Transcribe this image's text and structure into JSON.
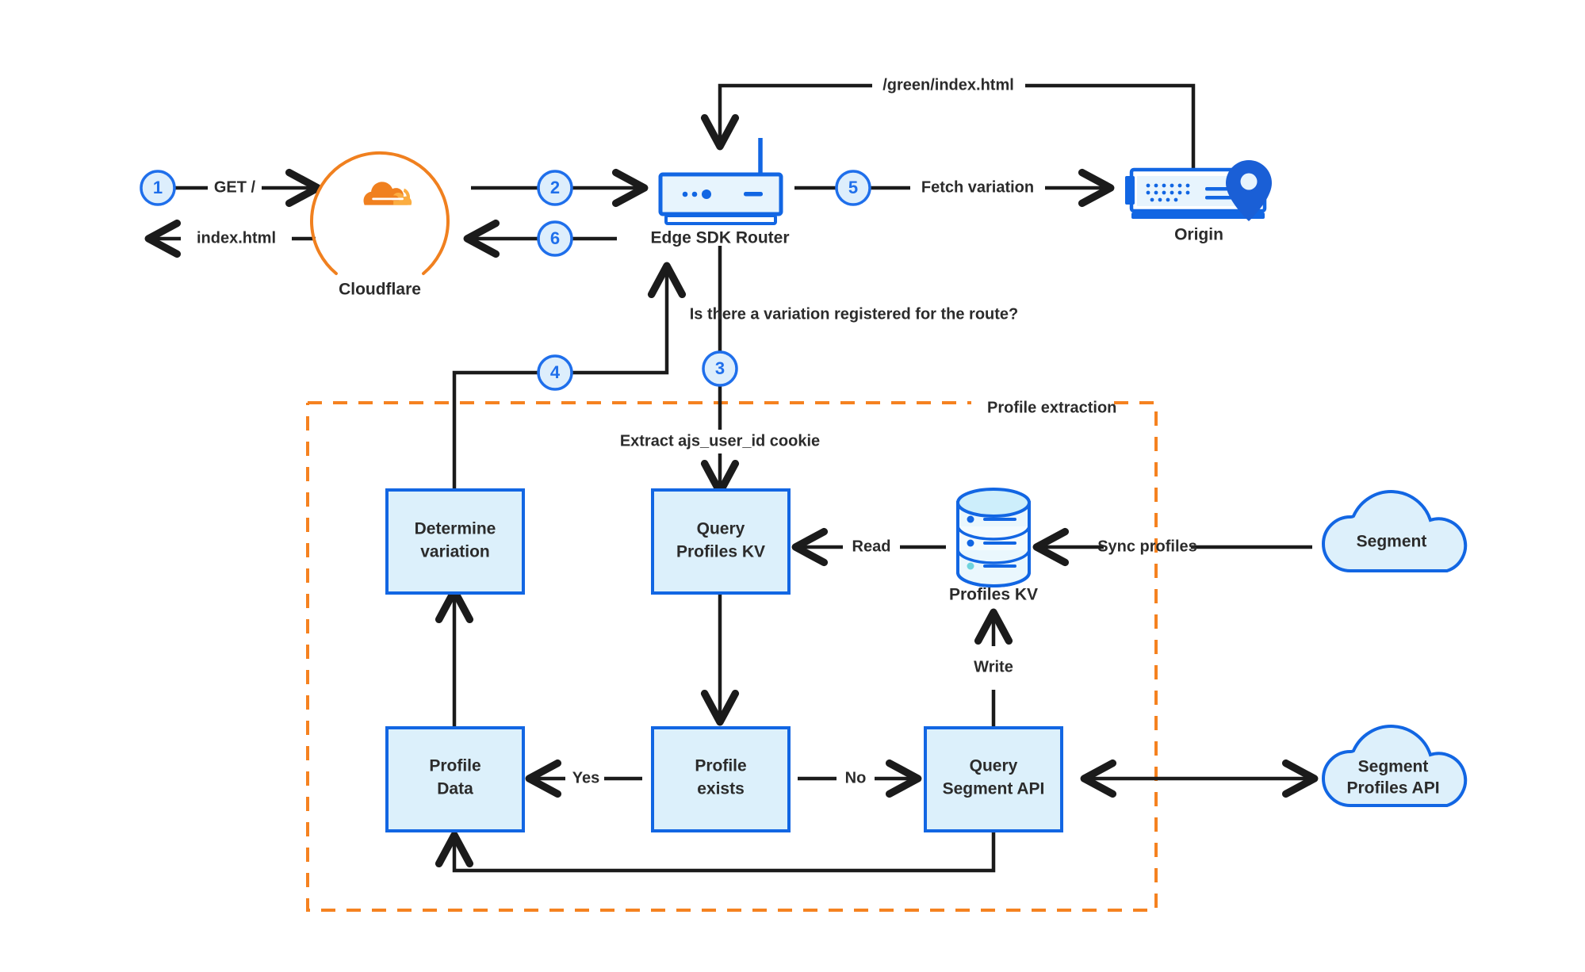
{
  "diagram": {
    "title": "Cloudflare Edge SDK personalization request flow",
    "colors": {
      "accent_blue": "#1266e3",
      "step_blue": "#1f6feb",
      "box_fill": "#dcf0fb",
      "dashed_orange": "#f58220",
      "cloudflare_orange_dark": "#f0801f",
      "cloudflare_orange_light": "#fbad41",
      "line_black": "#1b1b1b"
    }
  },
  "nodes": {
    "cloudflare": {
      "label": "Cloudflare",
      "icon": "cloudflare-logo"
    },
    "edge_router": {
      "label": "Edge SDK Router",
      "icon": "router-icon"
    },
    "origin": {
      "label": "Origin",
      "icon": "origin-server-icon"
    },
    "profiles_kv": {
      "label": "Profiles KV",
      "icon": "database-icon"
    },
    "segment": {
      "label": "Segment",
      "icon": "cloud-icon"
    },
    "segment_profiles_api": {
      "label": "Segment\nProfiles API",
      "line1": "Segment",
      "line2": "Profiles API",
      "icon": "cloud-icon"
    }
  },
  "boxes": {
    "determine_variation": {
      "line1": "Determine",
      "line2": "variation"
    },
    "query_profiles_kv": {
      "line1": "Query",
      "line2": "Profiles KV"
    },
    "profile_data": {
      "line1": "Profile",
      "line2": "Data"
    },
    "profile_exists": {
      "line1": "Profile",
      "line2": "exists"
    },
    "query_segment_api": {
      "line1": "Query",
      "line2": "Segment API"
    }
  },
  "steps": [
    {
      "n": "1",
      "at": "client request"
    },
    {
      "n": "2",
      "at": "cloudflare to edge router"
    },
    {
      "n": "3",
      "at": "edge router to profile extraction"
    },
    {
      "n": "4",
      "at": "determine variation back to edge router"
    },
    {
      "n": "5",
      "at": "edge router to origin"
    },
    {
      "n": "6",
      "at": "edge router back to cloudflare"
    }
  ],
  "edge_labels": {
    "get_root": "GET /",
    "index_html": "index.html",
    "green_index_html": "/green/index.html",
    "fetch_variation": "Fetch variation",
    "variation_question": "Is there a variation registered for the route?",
    "extract_cookie": "Extract ajs_user_id cookie",
    "read": "Read",
    "write": "Write",
    "sync_profiles": "Sync profiles",
    "yes": "Yes",
    "no": "No"
  },
  "groups": {
    "profile_extraction": {
      "label": "Profile extraction"
    }
  }
}
